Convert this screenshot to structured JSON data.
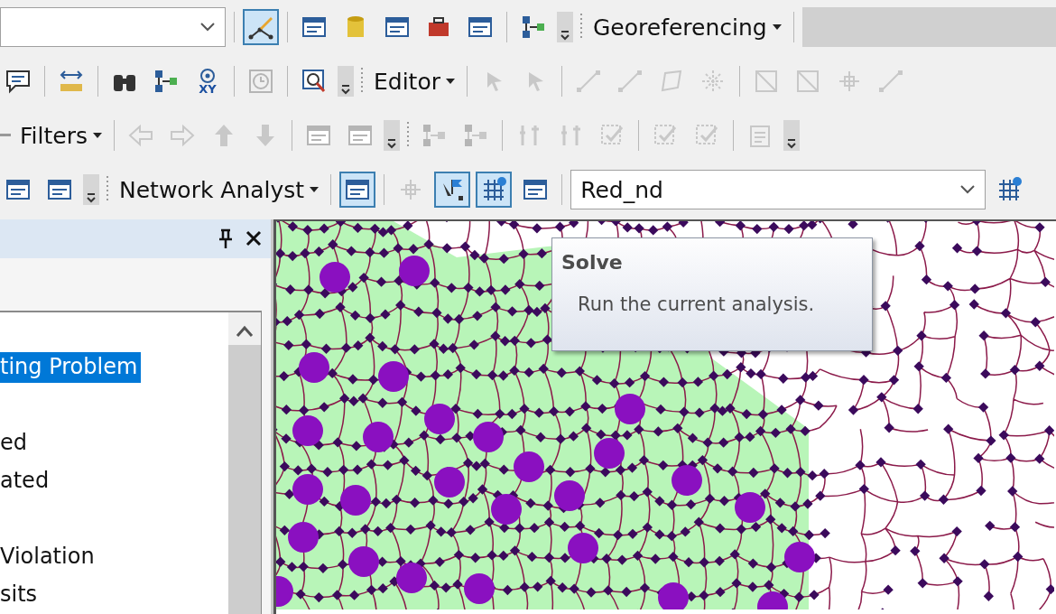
{
  "toolbars": [
    {
      "items": [
        {
          "kind": "combo",
          "disabled": false
        },
        {
          "kind": "sep"
        },
        {
          "kind": "button",
          "selected": true,
          "disabled": false
        },
        {
          "kind": "sep"
        },
        {
          "kind": "button",
          "selected": false,
          "disabled": false
        },
        {
          "kind": "button",
          "selected": false,
          "disabled": false
        },
        {
          "kind": "button",
          "selected": false,
          "disabled": false
        },
        {
          "kind": "button",
          "selected": false,
          "disabled": false
        },
        {
          "kind": "button",
          "selected": false,
          "disabled": false
        },
        {
          "kind": "sep"
        },
        {
          "kind": "button",
          "selected": false,
          "disabled": false
        },
        {
          "kind": "grip"
        },
        {
          "kind": "handle"
        },
        {
          "kind": "menu",
          "label": "Georeferencing"
        },
        {
          "kind": "sep"
        },
        {
          "kind": "combo",
          "disabled": true
        }
      ]
    },
    {
      "items": [
        {
          "kind": "button",
          "selected": false,
          "disabled": false
        },
        {
          "kind": "sep"
        },
        {
          "kind": "button",
          "selected": false,
          "disabled": false
        },
        {
          "kind": "sep"
        },
        {
          "kind": "button",
          "selected": false,
          "disabled": false
        },
        {
          "kind": "button",
          "selected": false,
          "disabled": false
        },
        {
          "kind": "button",
          "selected": false,
          "disabled": false,
          "label": "XY"
        },
        {
          "kind": "sep"
        },
        {
          "kind": "button",
          "selected": false,
          "disabled": true
        },
        {
          "kind": "sep"
        },
        {
          "kind": "button",
          "selected": false,
          "disabled": false
        },
        {
          "kind": "grip"
        },
        {
          "kind": "handle"
        },
        {
          "kind": "menu",
          "label": "Editor"
        },
        {
          "kind": "sep"
        },
        {
          "kind": "button",
          "selected": false,
          "disabled": true
        },
        {
          "kind": "button",
          "selected": false,
          "disabled": true
        },
        {
          "kind": "sep"
        },
        {
          "kind": "button",
          "selected": false,
          "disabled": true
        },
        {
          "kind": "button",
          "selected": false,
          "disabled": true
        },
        {
          "kind": "button",
          "selected": false,
          "disabled": true
        },
        {
          "kind": "button",
          "selected": false,
          "disabled": true
        },
        {
          "kind": "sep"
        },
        {
          "kind": "button",
          "selected": false,
          "disabled": true
        },
        {
          "kind": "button",
          "selected": false,
          "disabled": true
        },
        {
          "kind": "button",
          "selected": false,
          "disabled": true
        },
        {
          "kind": "button",
          "selected": false,
          "disabled": true
        }
      ]
    },
    {
      "items": [
        {
          "kind": "dash"
        },
        {
          "kind": "menu",
          "label": "Filters"
        },
        {
          "kind": "sep"
        },
        {
          "kind": "button",
          "selected": false,
          "disabled": true
        },
        {
          "kind": "button",
          "selected": false,
          "disabled": true
        },
        {
          "kind": "button",
          "selected": false,
          "disabled": true
        },
        {
          "kind": "button",
          "selected": false,
          "disabled": true
        },
        {
          "kind": "sep"
        },
        {
          "kind": "button",
          "selected": false,
          "disabled": true
        },
        {
          "kind": "button",
          "selected": false,
          "disabled": true
        },
        {
          "kind": "grip"
        },
        {
          "kind": "handle"
        },
        {
          "kind": "button",
          "selected": false,
          "disabled": true
        },
        {
          "kind": "button",
          "selected": false,
          "disabled": true
        },
        {
          "kind": "sep"
        },
        {
          "kind": "button",
          "selected": false,
          "disabled": true
        },
        {
          "kind": "button",
          "selected": false,
          "disabled": true
        },
        {
          "kind": "button",
          "selected": false,
          "disabled": true
        },
        {
          "kind": "sep"
        },
        {
          "kind": "button",
          "selected": false,
          "disabled": true
        },
        {
          "kind": "button",
          "selected": false,
          "disabled": true
        },
        {
          "kind": "sep"
        },
        {
          "kind": "button",
          "selected": false,
          "disabled": true
        },
        {
          "kind": "grip"
        }
      ]
    },
    {
      "items": [
        {
          "kind": "button",
          "selected": false,
          "disabled": false
        },
        {
          "kind": "button",
          "selected": false,
          "disabled": false
        },
        {
          "kind": "grip"
        },
        {
          "kind": "handle"
        },
        {
          "kind": "menu",
          "label": "Network Analyst"
        },
        {
          "kind": "sep"
        },
        {
          "kind": "button",
          "selected": true,
          "disabled": false
        },
        {
          "kind": "sep"
        },
        {
          "kind": "button",
          "selected": false,
          "disabled": true
        },
        {
          "kind": "button",
          "selected": true,
          "disabled": false
        },
        {
          "kind": "button",
          "selected": true,
          "disabled": false
        },
        {
          "kind": "button",
          "selected": false,
          "disabled": false
        },
        {
          "kind": "sep"
        },
        {
          "kind": "combo",
          "value": "Red_nd",
          "disabled": false
        },
        {
          "kind": "button",
          "selected": false,
          "disabled": false
        }
      ]
    }
  ],
  "panel": {
    "groups": [
      {
        "items": [
          {
            "label": "ting Problem",
            "selected": true
          }
        ]
      },
      {
        "items": [
          {
            "label": "ed",
            "selected": false
          },
          {
            "label": "ated",
            "selected": false
          }
        ]
      },
      {
        "items": [
          {
            "label": "Violation",
            "selected": false
          },
          {
            "label": "sits",
            "selected": false
          }
        ]
      }
    ]
  },
  "tooltip": {
    "title": "Solve",
    "text": "Run the current analysis."
  }
}
